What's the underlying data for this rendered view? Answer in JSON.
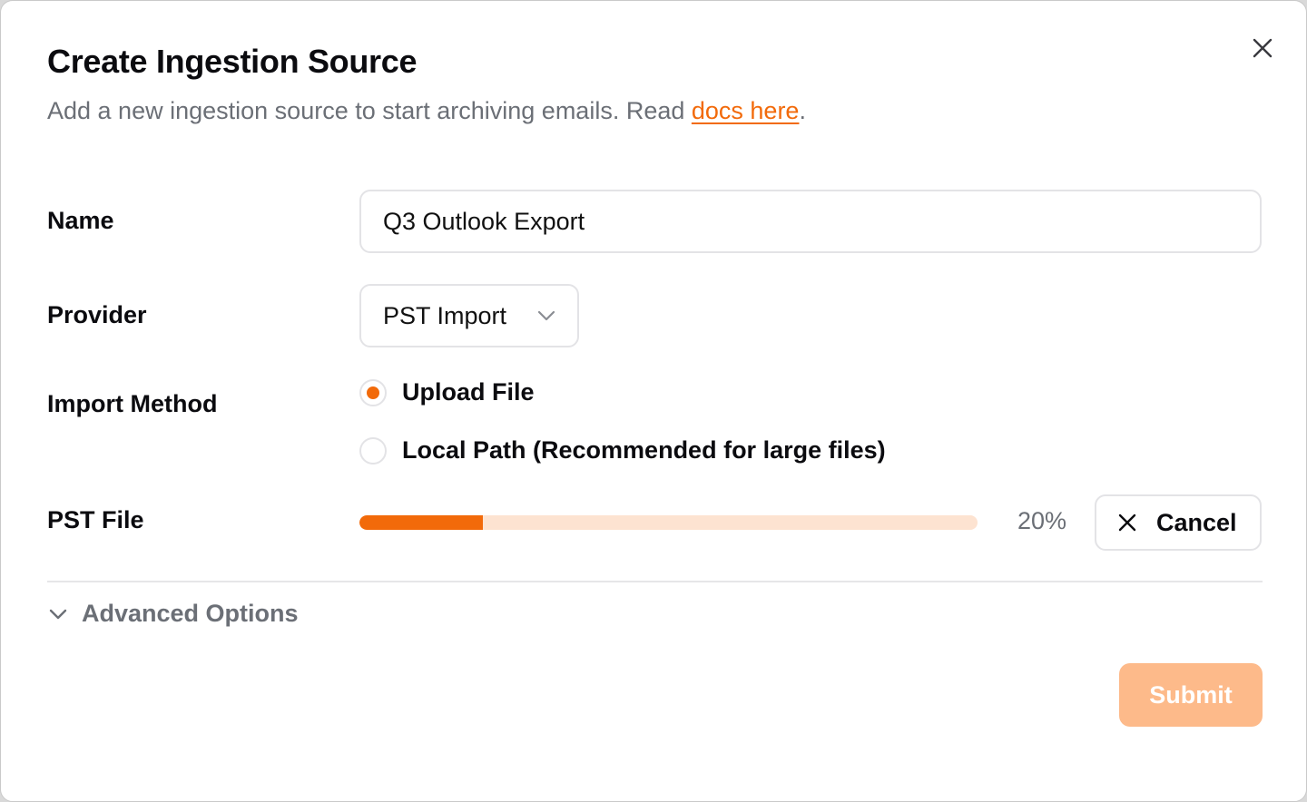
{
  "dialog": {
    "title": "Create Ingestion Source",
    "subtitle_prefix": "Add a new ingestion source to start archiving emails. Read ",
    "docs_link": "docs here",
    "subtitle_suffix": "."
  },
  "form": {
    "name": {
      "label": "Name",
      "value": "Q3 Outlook Export"
    },
    "provider": {
      "label": "Provider",
      "selected": "PST Import"
    },
    "import_method": {
      "label": "Import Method",
      "options": [
        {
          "label": "Upload File",
          "selected": true
        },
        {
          "label": "Local Path (Recommended for large files)",
          "selected": false
        }
      ]
    },
    "pst_file": {
      "label": "PST File",
      "progress_percent": 20,
      "progress_text": "20%",
      "cancel_label": "Cancel"
    }
  },
  "advanced": {
    "label": "Advanced Options"
  },
  "actions": {
    "submit_label": "Submit"
  },
  "colors": {
    "accent": "#f26a0a",
    "accent_light": "#fde3d1",
    "submit_disabled": "#fdba8a",
    "muted_text": "#6b6f76"
  },
  "icons": {
    "close": "close-icon",
    "provider_dropdown": "chevron-down-icon",
    "cancel": "close-icon",
    "advanced_toggle": "chevron-down-icon"
  }
}
